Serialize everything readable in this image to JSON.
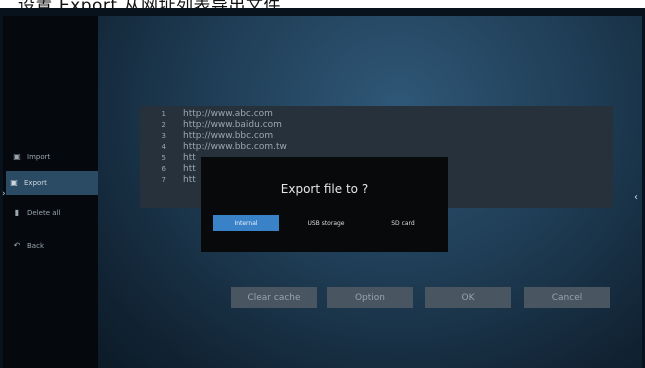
{
  "header_caption": "设置 Export 从网址列表导出文件",
  "sidebar": {
    "items": [
      {
        "label": "Import",
        "icon": "import-icon"
      },
      {
        "label": "Export",
        "icon": "export-icon"
      },
      {
        "label": "Delete all",
        "icon": "trash-icon"
      },
      {
        "label": "Back",
        "icon": "back-arrow-icon"
      }
    ],
    "active_index": 1
  },
  "url_list": {
    "rows": [
      {
        "num": "1",
        "url": "http://www.abc.com"
      },
      {
        "num": "2",
        "url": "http://www.baidu.com"
      },
      {
        "num": "3",
        "url": "http://www.bbc.com"
      },
      {
        "num": "4",
        "url": "http://www.bbc.com.tw"
      },
      {
        "num": "5",
        "url": "htt"
      },
      {
        "num": "6",
        "url": "htt"
      },
      {
        "num": "7",
        "url": "htt"
      }
    ]
  },
  "dialog": {
    "title": "Export file to ?",
    "options": [
      {
        "label": "Internal",
        "selected": true
      },
      {
        "label": "USB storage",
        "selected": false
      },
      {
        "label": "SD card",
        "selected": false
      }
    ]
  },
  "buttons": {
    "clear_cache": "Clear cache",
    "option": "Option",
    "ok": "OK",
    "cancel": "Cancel"
  },
  "colors": {
    "selected_option": "#3a82c8",
    "sidebar_active": "#2b4a64"
  }
}
